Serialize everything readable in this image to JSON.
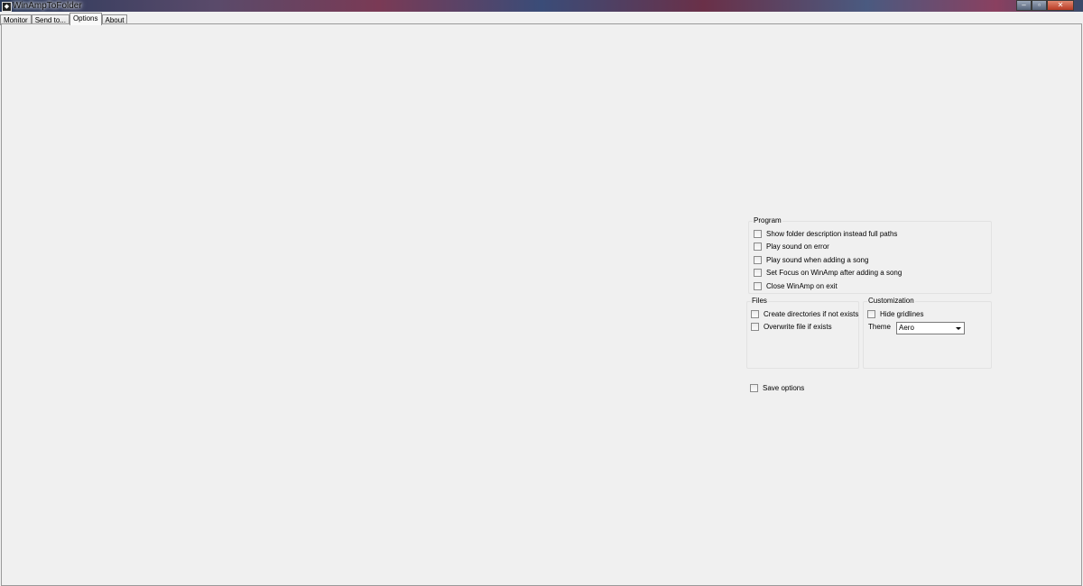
{
  "window": {
    "title": "WinAmpToFolder",
    "icon": "winamp-icon",
    "buttons": {
      "minimize": "‒",
      "maximize": "▫",
      "close": "✕"
    }
  },
  "tabs": [
    {
      "label": "Monitor",
      "active": false
    },
    {
      "label": "Send to...",
      "active": false
    },
    {
      "label": "Options",
      "active": true
    },
    {
      "label": "About",
      "active": false
    }
  ],
  "options": {
    "program": {
      "title": "Program",
      "items": [
        {
          "label": "Show folder description instead full paths",
          "checked": false
        },
        {
          "label": "Play sound on error",
          "checked": false
        },
        {
          "label": "Play sound when adding a song",
          "checked": false
        },
        {
          "label": "Set Focus on WinAmp after adding a song",
          "checked": false
        },
        {
          "label": "Close WinAmp on exit",
          "checked": false
        }
      ]
    },
    "files": {
      "title": "Files",
      "items": [
        {
          "label": "Create directories if not exists",
          "checked": false
        },
        {
          "label": "Overwrite file if exists",
          "checked": false
        }
      ]
    },
    "customization": {
      "title": "Customization",
      "hide_gridlines": {
        "label": "Hide gridlines",
        "checked": false
      },
      "theme_label": "Theme",
      "theme_value": "Aero"
    },
    "save_options": {
      "label": "Save options",
      "checked": false
    }
  }
}
